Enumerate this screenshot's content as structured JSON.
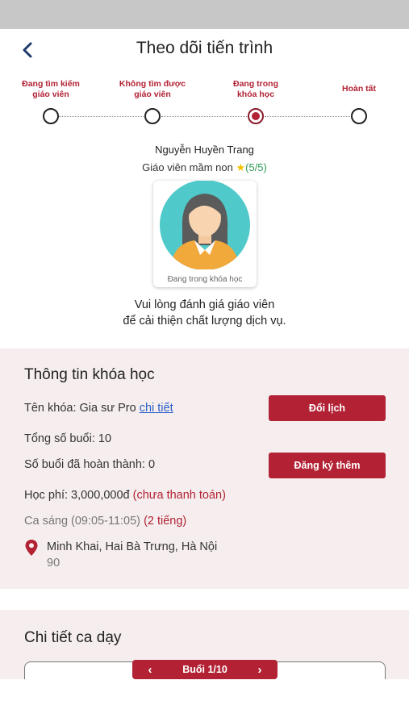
{
  "header": {
    "title": "Theo dõi tiến trình"
  },
  "steps": [
    {
      "label_line1": "Đang tìm kiếm",
      "label_line2": "giáo viên",
      "active": false
    },
    {
      "label_line1": "Không tìm được",
      "label_line2": "giáo viên",
      "active": false
    },
    {
      "label_line1": "Đang trong",
      "label_line2": "khóa học",
      "active": true
    },
    {
      "label_line1": "Hoàn tất",
      "label_line2": "",
      "active": false
    }
  ],
  "teacher": {
    "name": "Nguyễn Huyền Trang",
    "role": "Giáo viên mầm non",
    "star": "★",
    "rating": "(5/5)",
    "status_caption": "Đang trong khóa học"
  },
  "rate_message": {
    "line1": "Vui lòng đánh giá giáo viên",
    "line2": "để cải thiện chất lượng dịch vụ."
  },
  "course": {
    "section_title": "Thông tin khóa học",
    "name_label": "Tên khóa: Gia sư Pro",
    "detail_link": "chi tiết",
    "reschedule_button": "Đổi lịch",
    "total_sessions": "Tổng số buổi: 10",
    "completed_sessions": "Số buổi đã hoàn thành: 0",
    "register_more_button": "Đăng ký thêm",
    "fee": "Học phí: 3,000,000đ",
    "fee_status": "(chưa thanh toán)",
    "shift": "Ca sáng (09:05-11:05)",
    "shift_duration": "(2 tiếng)",
    "address": "Minh Khai, Hai Bà Trưng, Hà Nội",
    "address_extra": "90"
  },
  "session_detail": {
    "section_title": "Chi tiết ca dạy",
    "pager_label": "Buổi 1/10",
    "prev": "‹",
    "next": "›"
  },
  "colors": {
    "accent": "#b22234",
    "section_bg": "#f6eeee",
    "link": "#2a5fc7",
    "rating": "#2e9d57"
  },
  "icons": {
    "back": "chevron-left-icon",
    "location": "map-pin-icon"
  }
}
